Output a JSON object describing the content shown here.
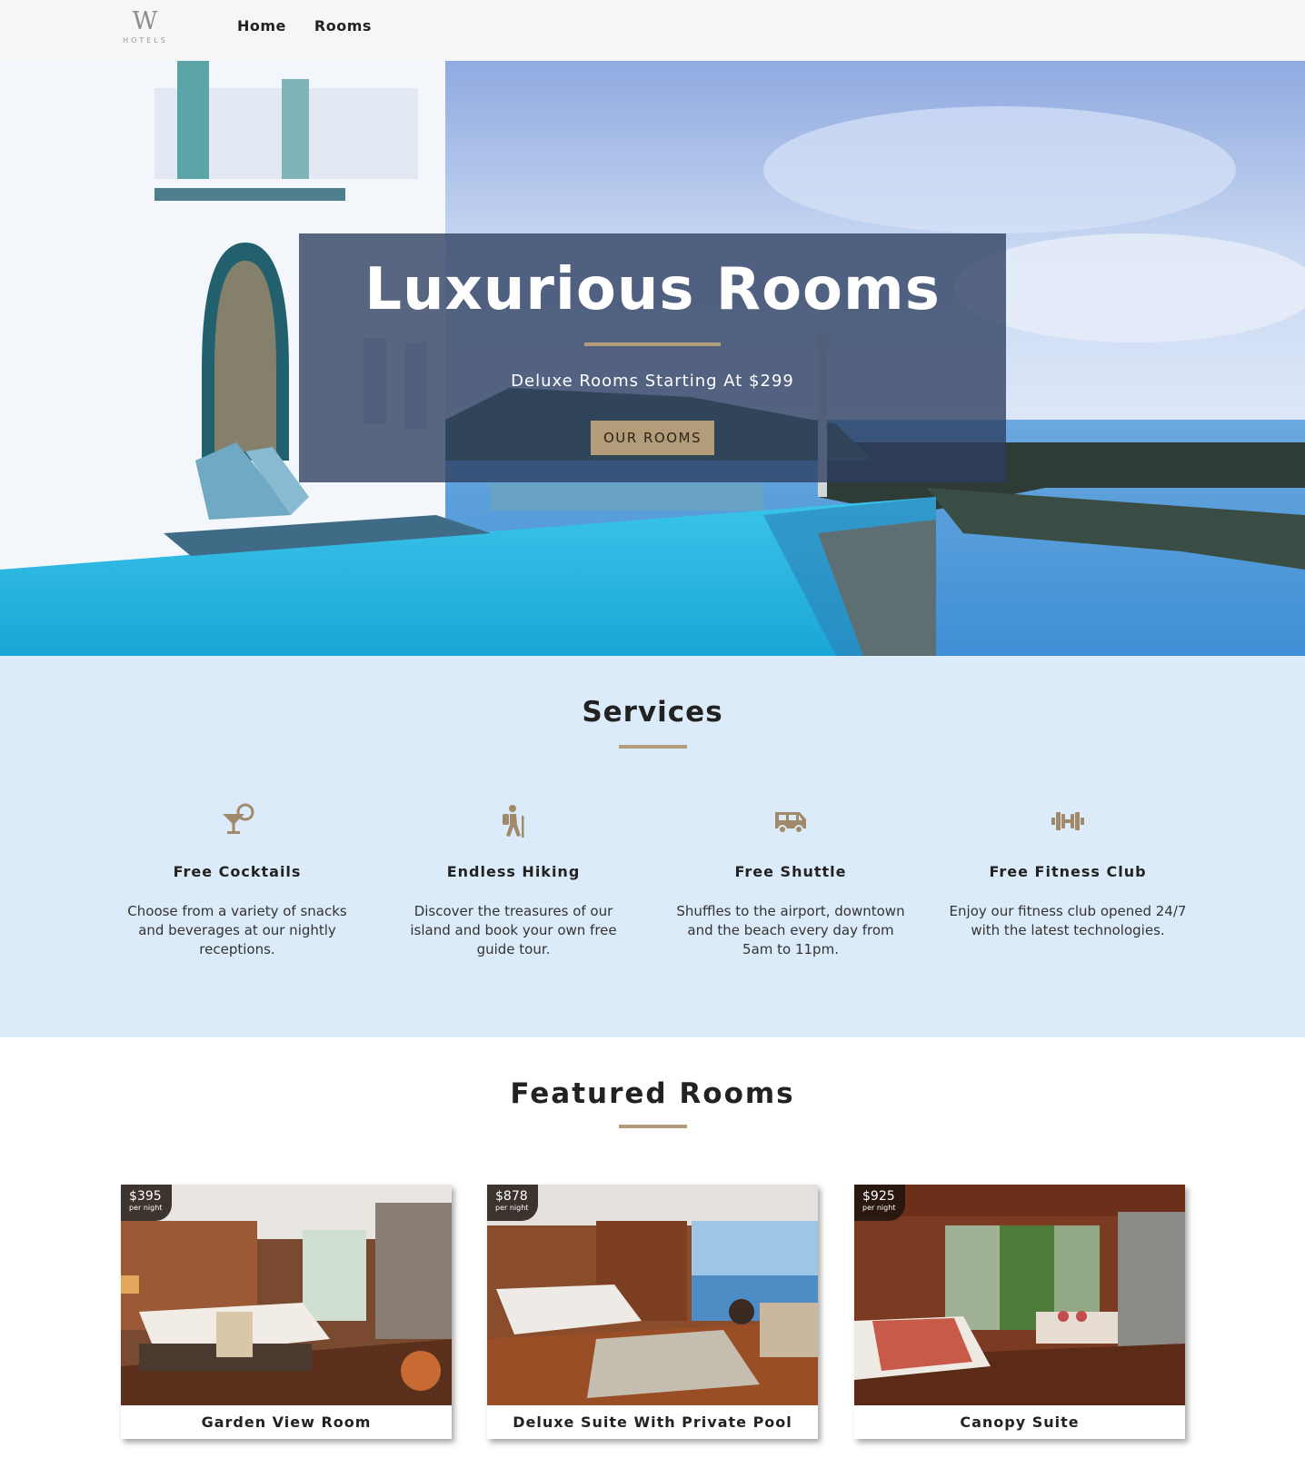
{
  "nav": {
    "logo_mark": "W",
    "logo_sub": "HOTELS",
    "links": [
      "Home",
      "Rooms"
    ]
  },
  "hero": {
    "title": "Luxurious Rooms",
    "subtitle": "Deluxe Rooms Starting At $299",
    "button": "OUR ROOMS"
  },
  "services": {
    "title": "Services",
    "items": [
      {
        "icon": "cocktail-icon",
        "name": "Free Cocktails",
        "desc": "Choose from a variety of snacks and beverages at our nightly receptions."
      },
      {
        "icon": "hiking-icon",
        "name": "Endless Hiking",
        "desc": "Discover the treasures of our island and book your own free guide tour."
      },
      {
        "icon": "shuttle-icon",
        "name": "Free Shuttle",
        "desc": "Shuffles to the airport, downtown and the beach every day from 5am to 11pm."
      },
      {
        "icon": "dumbbell-icon",
        "name": "Free Fitness Club",
        "desc": "Enjoy our fitness club opened 24/7 with the latest technologies."
      }
    ]
  },
  "featured": {
    "title": "Featured Rooms",
    "rooms": [
      {
        "name": "Garden View Room",
        "price": "$395",
        "unit": "per night"
      },
      {
        "name": "Deluxe Suite With Private Pool",
        "price": "$878",
        "unit": "per night"
      },
      {
        "name": "Canopy Suite",
        "price": "$925",
        "unit": "per night"
      }
    ]
  },
  "colors": {
    "accent": "#b39c79",
    "nav_bg": "#f6f6f6",
    "services_bg": "#dcebfa",
    "hero_box": "#2d3e5f"
  }
}
